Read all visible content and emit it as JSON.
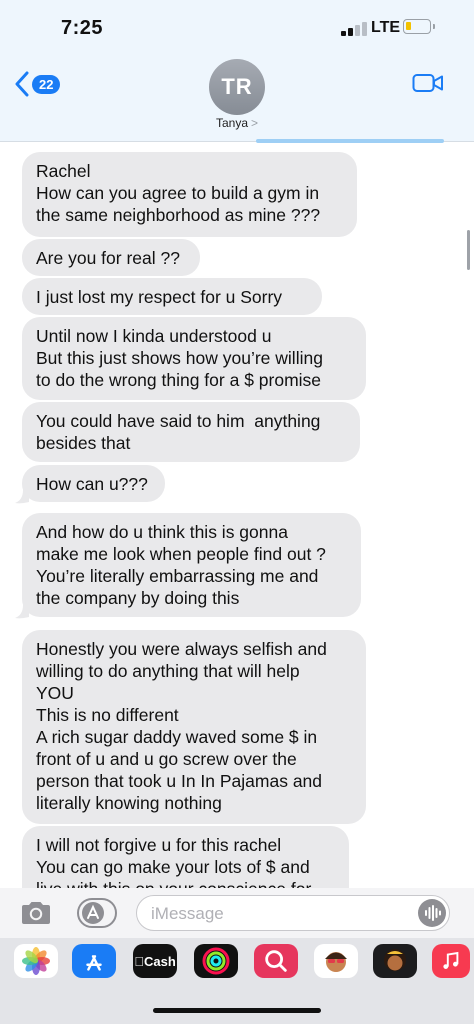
{
  "status": {
    "time": "7:25",
    "network": "LTE"
  },
  "header": {
    "back_count": "22",
    "avatar_initials": "TR",
    "contact_name": "Tanya",
    "contact_chevron": ">"
  },
  "messages": [
    {
      "lines": [
        "Rachel",
        "How can you agree to build a gym in",
        "the same neighborhood as mine ???"
      ]
    },
    {
      "lines": [
        "Are you for real ??"
      ]
    },
    {
      "lines": [
        "I just lost my respect for u Sorry"
      ]
    },
    {
      "lines": [
        "Until now I kinda understood u",
        "But this just shows how you’re willing",
        "to do the wrong thing for a $ promise"
      ]
    },
    {
      "lines": [
        "You could have said to him  anything",
        "besides that"
      ]
    },
    {
      "lines": [
        "How can u???"
      ]
    },
    {
      "lines": [
        "And how do u think this is gonna",
        "make me look when people find out ?",
        "You’re literally embarrassing me and",
        "the company by doing this"
      ]
    },
    {
      "lines": [
        "Honestly you were always selfish and",
        "willing to do anything that will help",
        "YOU",
        "This is no different",
        "A rich sugar daddy waved some $ in",
        "front of u and u go screw over the",
        "person that took u In In Pajamas and",
        "literally knowing nothing"
      ]
    },
    {
      "lines": [
        "I will not forgive u for this rachel",
        "You can go make your lots of $ and",
        "live with this on your conscience for"
      ]
    }
  ],
  "input": {
    "placeholder": "iMessage"
  },
  "app_drawer": [
    {
      "name": "Photos",
      "icon": "photos-icon"
    },
    {
      "name": "App Store",
      "icon": "app-store-icon"
    },
    {
      "name": "Cash",
      "icon": "apple-cash-icon",
      "label": "Cash"
    },
    {
      "name": "Activity",
      "icon": "activity-icon"
    },
    {
      "name": "Search",
      "icon": "search-images-icon"
    },
    {
      "name": "Memoji",
      "icon": "memoji-icon"
    },
    {
      "name": "Memoji Stickers",
      "icon": "memoji-stickers-icon"
    },
    {
      "name": "Music",
      "icon": "music-icon"
    }
  ],
  "colors": {
    "accent": "#1a7cf5",
    "bubble_gray": "#e9e9eb",
    "header_bg": "#eef6fd"
  }
}
